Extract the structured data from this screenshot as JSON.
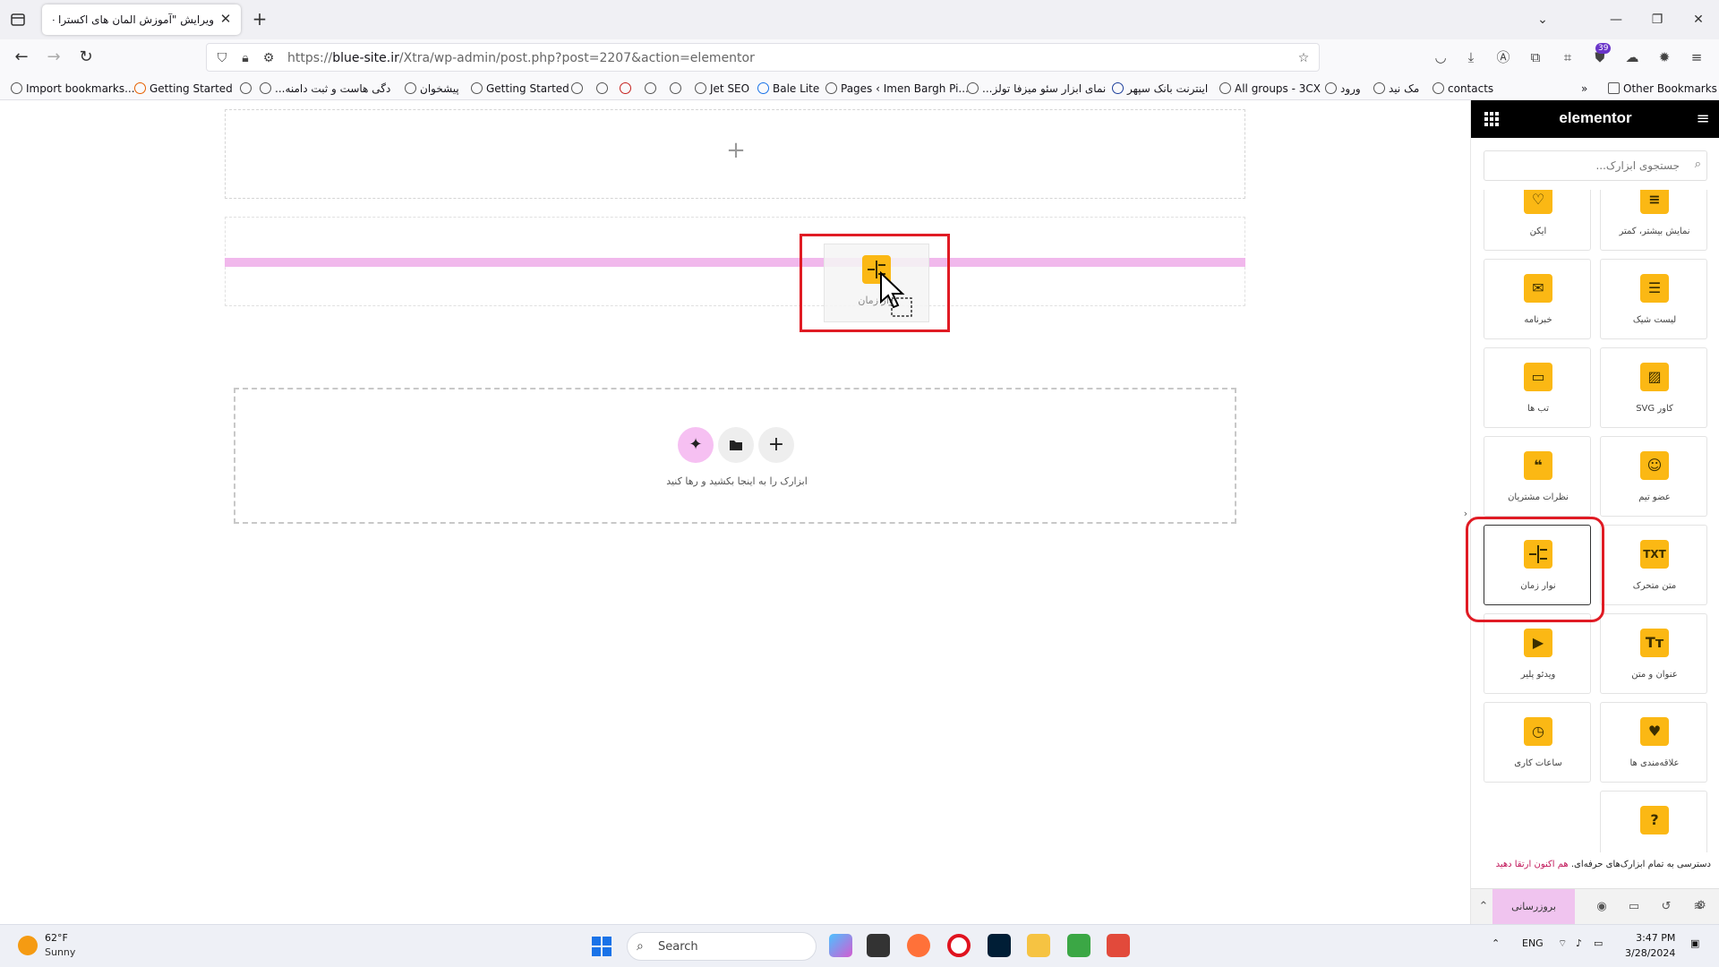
{
  "browser": {
    "tab_title": "ویرایش \"آموزش المان های اکسترا – ...",
    "url_prefix": "https://",
    "url_domain": "blue-site.ir",
    "url_path": "/Xtra/wp-admin/post.php?post=2207&action=elementor",
    "extension_badge": "39",
    "bookmarks": [
      "Import bookmarks...",
      "Getting Started",
      "...دگی هاست و ثبت دامنه",
      "پیشخوان",
      "Getting Started",
      "Jet SEO",
      "Bale Lite",
      "Pages ‹ Imen Bargh Pi...",
      "...نمای ابزار سئو میزفا تولز",
      "اینترنت بانک سپهر",
      "All groups - 3CX",
      "ورود",
      "مک نید",
      "contacts"
    ],
    "other_bookmarks": "Other Bookmarks"
  },
  "canvas": {
    "drag_ghost_label": "نوار زمان",
    "drop_hint": "ابزارک را به اینجا بکشید و رها کنید"
  },
  "panel": {
    "logo": "elementor",
    "search_placeholder": "جستجوی ابزارک...",
    "widgets": [
      {
        "label": "نمایش بیشتر، کمتر",
        "icon": "read-more-icon"
      },
      {
        "label": "آیکن",
        "icon": "heart-icon"
      },
      {
        "label": "لیست شیک",
        "icon": "list-icon"
      },
      {
        "label": "خبرنامه",
        "icon": "mail-icon"
      },
      {
        "label": "کاور SVG",
        "icon": "svg-cover-icon"
      },
      {
        "label": "تب ها",
        "icon": "folder-icon"
      },
      {
        "label": "عضو تیم",
        "icon": "team-icon"
      },
      {
        "label": "نظرات مشتریان",
        "icon": "quote-icon"
      },
      {
        "label": "متن متحرک",
        "icon": "txt-icon"
      },
      {
        "label": "نوار زمان",
        "icon": "timeline-icon"
      },
      {
        "label": "عنوان و متن",
        "icon": "heading-icon"
      },
      {
        "label": "ویدئو پلیر",
        "icon": "video-icon"
      },
      {
        "label": "علاقه‌مندی ها",
        "icon": "wishlist-icon"
      },
      {
        "label": "ساعات کاری",
        "icon": "clock-icon"
      },
      {
        "label": "",
        "icon": "support-icon"
      }
    ],
    "promo_text": "دسترسی به تمام ابزارک‌های حرفه‌ای.",
    "promo_link": "هم اکنون ارتقا دهید",
    "upgrade_label": "بروزرسانی"
  },
  "taskbar": {
    "temperature": "62°F",
    "weather": "Sunny",
    "search": "Search",
    "language": "ENG",
    "time": "3:47 PM",
    "date": "3/28/2024"
  },
  "colors": {
    "accent": "#fbb814",
    "highlight_red": "#e01b24",
    "drop_line": "#f1b8ec"
  }
}
